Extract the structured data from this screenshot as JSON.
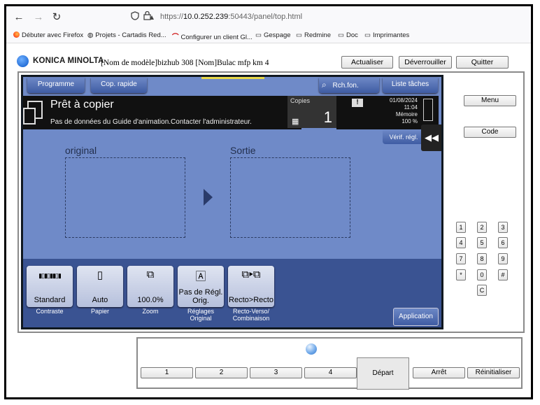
{
  "browser": {
    "url_prefix": "https://",
    "url_host": "10.0.252.239",
    "url_rest": ":50443/panel/top.html",
    "nav": {
      "back": "←",
      "forward": "→",
      "reload": "↻"
    },
    "bookmarks": [
      {
        "label": "Débuter avec Firefox",
        "icon": "firefox-icon"
      },
      {
        "label": "Projets - Cartadis Red...",
        "icon": "globe-icon"
      },
      {
        "label": "Configurer un client Gl...",
        "icon": "arc-icon"
      },
      {
        "label": "Gespage",
        "icon": "folder-icon"
      },
      {
        "label": "Redmine",
        "icon": "folder-icon"
      },
      {
        "label": "Doc",
        "icon": "folder-icon"
      },
      {
        "label": "Imprimantes",
        "icon": "folder-icon"
      }
    ]
  },
  "header": {
    "brand": "KONICA MINOLTA",
    "model": "[Nom de modèle]bizhub 308 [Nom]Bulac mfp km 4",
    "refresh": "Actualiser",
    "unlock": "Déverrouiller",
    "quit": "Quitter"
  },
  "screen": {
    "tabs": {
      "program": "Programme",
      "quick_copy": "Cop. rapide",
      "search": "Rch.fon.",
      "jobs": "Liste tâches"
    },
    "status_title": "Prêt à copier",
    "status_message": "Pas de données du Guide d'animation.Contacter l'administrateur.",
    "copies_label": "Copies",
    "copies_value": "1",
    "date": "01/08/2024",
    "time": "11:04",
    "memory_label": "Mémoire",
    "memory_value": "100 %",
    "verify": "Vérif. régl.",
    "original_label": "original",
    "output_label": "Sortie",
    "functions": [
      {
        "value": "Standard",
        "label": "Contraste",
        "icon": "contrast-icon"
      },
      {
        "value": "Auto",
        "label": "Papier",
        "icon": "paper-icon"
      },
      {
        "value": "100.0%",
        "label": "Zoom",
        "icon": "zoom-icon"
      },
      {
        "value": "Pas de Régl. Orig.",
        "label": "Réglages Original",
        "icon": "original-icon"
      },
      {
        "value": "Recto>Recto",
        "label": "Recto-Verso/ Combinaison",
        "icon": "duplex-icon"
      }
    ],
    "application": "Application"
  },
  "side": {
    "menu": "Menu",
    "code": "Code",
    "keypad": [
      "1",
      "2",
      "3",
      "4",
      "5",
      "6",
      "7",
      "8",
      "9",
      "*",
      "0",
      "#",
      "C"
    ]
  },
  "lower": {
    "keys": [
      "1",
      "2",
      "3",
      "4"
    ],
    "start": "Départ",
    "stop": "Arrêt",
    "reset": "Réinitialiser"
  }
}
